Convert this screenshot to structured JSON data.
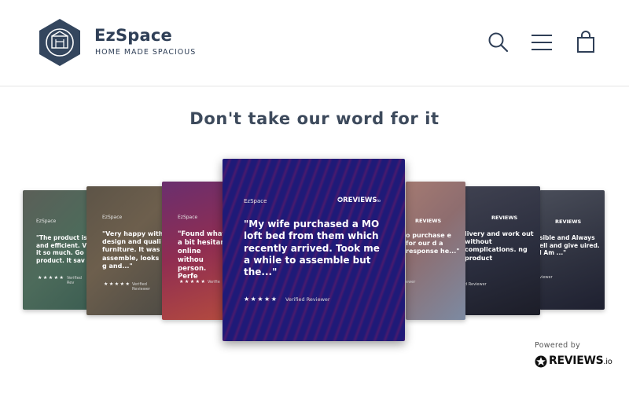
{
  "header": {
    "brand_name": "EzSpace",
    "brand_tagline": "HOME MADE SPACIOUS",
    "icons": [
      "search-icon",
      "hamburger-menu-icon",
      "cart-icon"
    ],
    "brand_color": "#2f3f57"
  },
  "section": {
    "title": "Don't take our word for it"
  },
  "carousel": {
    "main": {
      "brand": "EzSpace",
      "provider": "REVIEWS",
      "provider_suffix": "io",
      "quote": "\"My wife purchased a MO loft bed from them which recently arrived. Took me a while to assemble but the...\"",
      "stars": "★★★★★",
      "verified": "Verified Reviewer"
    },
    "left": [
      {
        "brand": "EzSpace",
        "quote": "\"The product is and efficient. V it so much. Go product. It sav",
        "stars": "★★★★★",
        "verified": "Verified Rev"
      },
      {
        "brand": "EzSpace",
        "quote": "\"Very happy with design and quali furniture. It was assemble, looks g and...\"",
        "stars": "★★★★★",
        "verified": "Verified Reviewer"
      },
      {
        "brand": "EzSpace",
        "quote": "\"Found what a bit hesitan online withou person. Perfe",
        "stars": "★★★★★",
        "verified": "Verifie"
      }
    ],
    "right": [
      {
        "provider": "REVIEWS",
        "quote": "o purchase e for our d a response he...\"",
        "verified": "ewer"
      },
      {
        "provider": "REVIEWS",
        "quote": "livery and work out without complications. ng product",
        "verified": "d Reviewer"
      },
      {
        "provider": "REVIEWS",
        "quote": "sible and Always ell and give uired. I Am ...\"",
        "verified": "viewer"
      }
    ]
  },
  "footer": {
    "powered_by": "Powered by",
    "provider": "REVIEWS",
    "provider_suffix": ".io"
  }
}
